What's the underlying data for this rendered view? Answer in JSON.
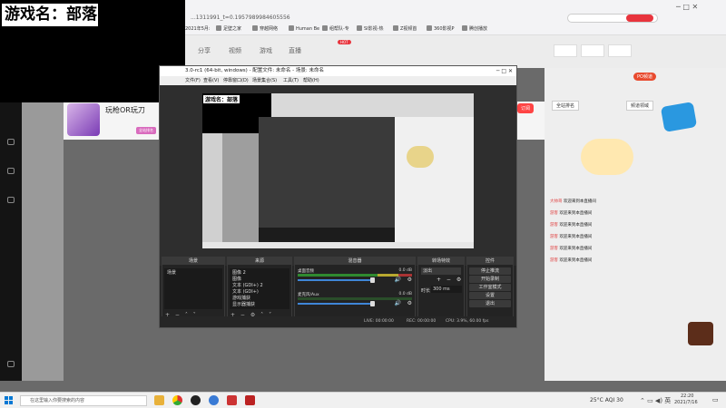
{
  "overlay": {
    "label": "游戏名：部落"
  },
  "browser": {
    "url": "...1311991_t=0.1957989984605556",
    "bookmarks": [
      "2021年5月:",
      "足壁之家",
      "穿越网络",
      "Human Be",
      "组帮队-专",
      "SI影视-热",
      "Z视频首",
      "360影视P",
      "腾创播放"
    ],
    "nav": [
      "分享",
      "视频",
      "游戏",
      "直播"
    ],
    "nav_badge": "HOT"
  },
  "stream": {
    "title": "玩枪OR玩刀",
    "buttons": [
      "PO频道",
      "订阅"
    ],
    "badges": [
      "全站排名",
      "频道领域"
    ]
  },
  "obs": {
    "title": "3.0-rc1 (64-bit, windows) - 配置文件: 未命名 - 场景: 未命名",
    "menu": [
      "文件(F)",
      "查看(V)",
      "停靠窗口(D)",
      "场景集合(S)",
      "工具(T)",
      "帮助(H)"
    ],
    "preview_label": "游戏名：部落",
    "docks": {
      "scenes": {
        "title": "场景",
        "items": [
          "场景"
        ]
      },
      "sources": {
        "title": "来源",
        "items": [
          "图像 2",
          "图像",
          "文本 (GDI+) 2",
          "文本 (GDI+)",
          "游戏捕获",
          "显示器捕获"
        ]
      },
      "mixer": {
        "title": "混音器",
        "channels": [
          {
            "name": "桌面音频",
            "db": "0.0 dB"
          },
          {
            "name": "麦克风/Aux",
            "db": "0.0 dB"
          }
        ]
      },
      "transitions": {
        "title": "转场特效",
        "type": "淡出",
        "duration_label": "时长",
        "duration": "300 ms"
      },
      "controls": {
        "title": "控件",
        "buttons": [
          "停止推流",
          "开始录制",
          "工作室模式",
          "设置",
          "退出"
        ]
      }
    },
    "status": {
      "live": "LIVE: 00:00:00",
      "rec": "REC: 00:00:00",
      "cpu": "CPU: 3.9%, 60.00 fps"
    }
  },
  "chat": {
    "messages": [
      {
        "user": "大帅哥",
        "text": "欢迎来到本直播间"
      },
      {
        "user": "游客",
        "text": "欢迎来到本直播间"
      },
      {
        "user": "游客",
        "text": "欢迎来到本直播间"
      },
      {
        "user": "游客",
        "text": "欢迎来到本直播间"
      },
      {
        "user": "游客",
        "text": "欢迎来到本直播间"
      },
      {
        "user": "游客",
        "text": "欢迎来到本直播间"
      }
    ]
  },
  "taskbar": {
    "search_placeholder": "在这里输入你要搜索的内容",
    "weather": "25°C AQI 30",
    "time": "22:20",
    "date": "2021/7/16"
  },
  "colors": {
    "accent": "#e8343d",
    "obs_bg": "#262626",
    "meter_green": "#2f8a2f"
  }
}
